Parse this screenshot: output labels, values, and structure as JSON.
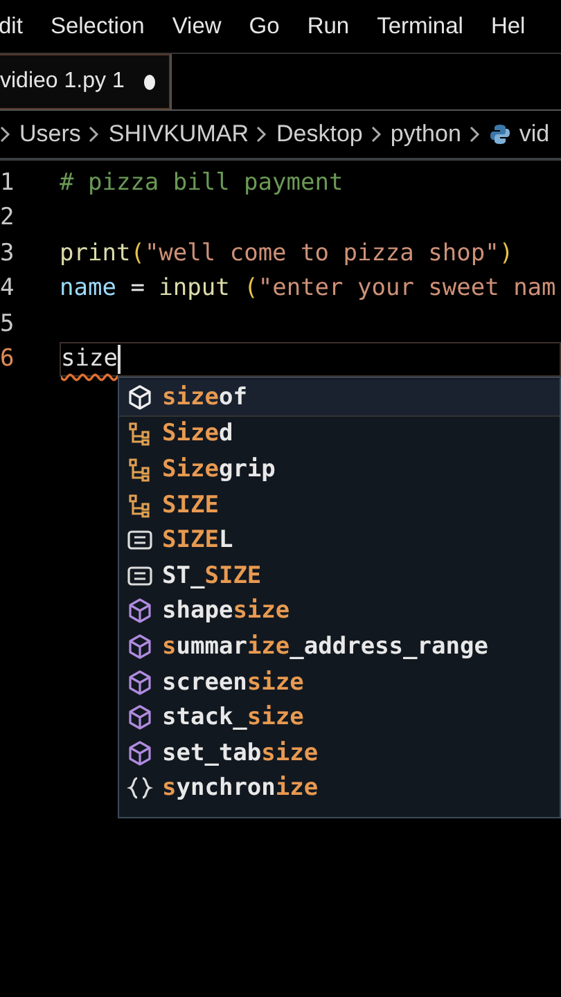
{
  "menu": [
    {
      "label": "dit"
    },
    {
      "label": "Selection"
    },
    {
      "label": "View"
    },
    {
      "label": "Go"
    },
    {
      "label": "Run"
    },
    {
      "label": "Terminal"
    },
    {
      "label": "Hel"
    }
  ],
  "tab": {
    "label": "vidieo 1.py",
    "problems": "1",
    "dirty": true,
    "selected": true
  },
  "breadcrumbs": [
    {
      "label": "Users"
    },
    {
      "label": "SHIVKUMAR"
    },
    {
      "label": "Desktop"
    },
    {
      "label": "python"
    },
    {
      "label": "vid",
      "kind": "python-file"
    }
  ],
  "lines": [
    {
      "number": "1",
      "current": false,
      "tokens": [
        {
          "text": "# pizza bill payment",
          "kind": "comment"
        }
      ]
    },
    {
      "number": "2",
      "current": false
    },
    {
      "number": "3",
      "current": false,
      "tokens": [
        {
          "text": "print",
          "kind": "function"
        },
        {
          "text": "(",
          "kind": "paren"
        },
        {
          "text": "\"well come to pizza shop\"",
          "kind": "string"
        },
        {
          "text": ")",
          "kind": "paren"
        }
      ]
    },
    {
      "number": "4",
      "current": false,
      "tokens": [
        {
          "text": "name",
          "kind": "variable"
        },
        {
          "text": " = ",
          "kind": "plain"
        },
        {
          "text": "input ",
          "kind": "function"
        },
        {
          "text": "(",
          "kind": "paren"
        },
        {
          "text": "\"enter your sweet nam",
          "kind": "string"
        }
      ]
    },
    {
      "number": "5",
      "current": false
    },
    {
      "number": "6",
      "current": true,
      "tokens": [
        {
          "text": "size",
          "kind": "plain",
          "error": true
        }
      ]
    }
  ],
  "suggestions": [
    {
      "kind": "module",
      "selected": true,
      "parts": [
        {
          "text": "size",
          "match": true
        },
        {
          "text": "of",
          "match": false
        }
      ]
    },
    {
      "kind": "class",
      "selected": false,
      "parts": [
        {
          "text": "Size",
          "match": true
        },
        {
          "text": "d",
          "match": false
        }
      ]
    },
    {
      "kind": "class",
      "selected": false,
      "parts": [
        {
          "text": "Size",
          "match": true
        },
        {
          "text": "grip",
          "match": false
        }
      ]
    },
    {
      "kind": "class",
      "selected": false,
      "parts": [
        {
          "text": "SIZE",
          "match": true
        }
      ]
    },
    {
      "kind": "constant",
      "selected": false,
      "parts": [
        {
          "text": "SIZE",
          "match": true
        },
        {
          "text": "L",
          "match": false
        }
      ]
    },
    {
      "kind": "constant",
      "selected": false,
      "parts": [
        {
          "text": "ST_",
          "match": false
        },
        {
          "text": "SIZE",
          "match": true
        }
      ]
    },
    {
      "kind": "module",
      "selected": false,
      "parts": [
        {
          "text": "shape",
          "match": false
        },
        {
          "text": "size",
          "match": true
        }
      ]
    },
    {
      "kind": "module",
      "selected": false,
      "parts": [
        {
          "text": "s",
          "match": true
        },
        {
          "text": "ummar",
          "match": false
        },
        {
          "text": "ize",
          "match": true
        },
        {
          "text": "_address_range",
          "match": false
        }
      ]
    },
    {
      "kind": "module",
      "selected": false,
      "parts": [
        {
          "text": "screen",
          "match": false
        },
        {
          "text": "size",
          "match": true
        }
      ]
    },
    {
      "kind": "module",
      "selected": false,
      "parts": [
        {
          "text": "stack_",
          "match": false
        },
        {
          "text": "size",
          "match": true
        }
      ]
    },
    {
      "kind": "module",
      "selected": false,
      "parts": [
        {
          "text": "set_tab",
          "match": false
        },
        {
          "text": "size",
          "match": true
        }
      ]
    },
    {
      "kind": "namespace",
      "selected": false,
      "parts": [
        {
          "text": "s",
          "match": true
        },
        {
          "text": "ynchron",
          "match": false
        },
        {
          "text": "ize",
          "match": true
        }
      ]
    }
  ]
}
